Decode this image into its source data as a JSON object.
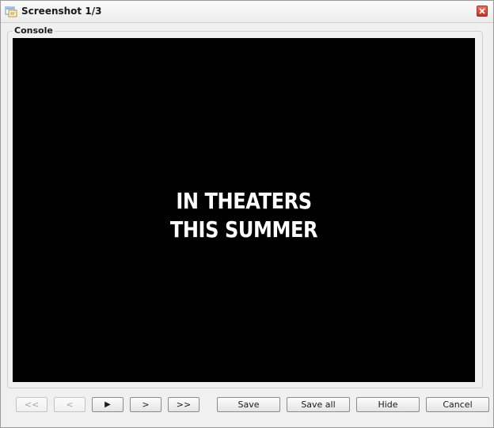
{
  "window": {
    "title": "Screenshot 1/3"
  },
  "console": {
    "legend": "Console",
    "screen_text_line1": "IN THEATERS",
    "screen_text_line2": "THIS SUMMER"
  },
  "nav": {
    "first_label": "<<",
    "prev_label": "<",
    "play_label": "▶",
    "next_label": ">",
    "last_label": ">>"
  },
  "actions": {
    "save_label": "Save",
    "save_all_label": "Save all",
    "hide_label": "Hide",
    "cancel_label": "Cancel"
  },
  "colors": {
    "screen_background": "#000000",
    "screen_text": "#ffffff",
    "close_button": "#d84030"
  },
  "icons": {
    "title": "screenshot-window-icon",
    "close": "close-icon",
    "play": "play-icon"
  }
}
